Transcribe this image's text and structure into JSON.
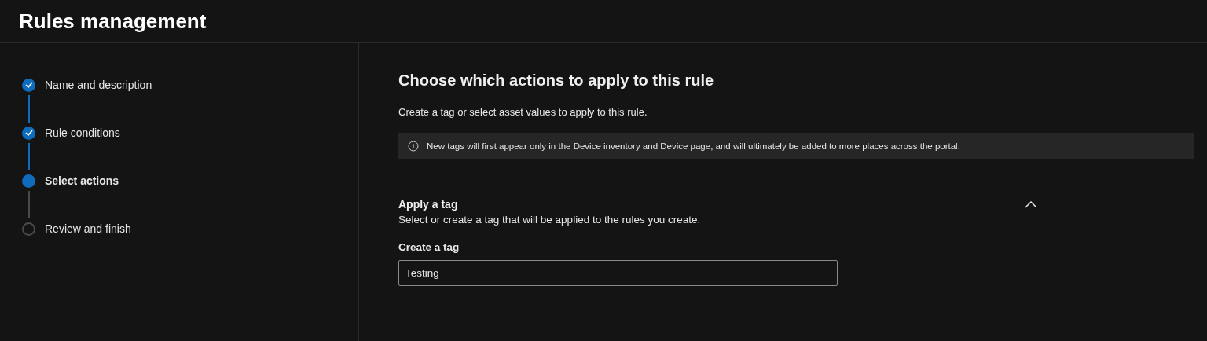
{
  "header": {
    "title": "Rules management"
  },
  "steps": [
    {
      "label": "Name and description",
      "completed": true,
      "selected": false
    },
    {
      "label": "Rule conditions",
      "completed": true,
      "selected": false
    },
    {
      "label": "Select actions",
      "completed": false,
      "selected": true
    },
    {
      "label": "Review and finish",
      "completed": false,
      "selected": false
    }
  ],
  "content": {
    "title": "Choose which actions to apply to this rule",
    "description": "Create a tag or select asset values to apply to this rule.",
    "info_bar": {
      "text": "New tags will first appear only in the Device inventory and Device page, and will ultimately be added to more places across the portal."
    },
    "section": {
      "title": "Apply a tag",
      "expanded": true,
      "description": "Select or create a tag that will be applied to the rules you create.",
      "field": {
        "label": "Create a tag",
        "value": "Testing"
      }
    }
  }
}
